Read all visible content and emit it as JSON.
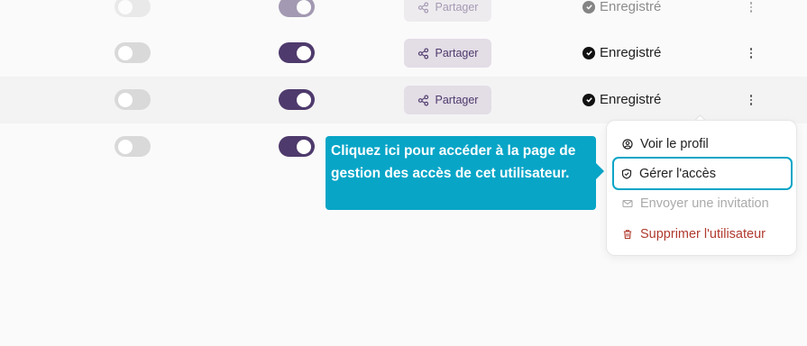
{
  "rows": [
    {
      "toggle1": false,
      "toggle2": true,
      "share_label": "Partager",
      "status": "Enregistré"
    },
    {
      "toggle1": false,
      "toggle2": true,
      "share_label": "Partager",
      "status": "Enregistré"
    },
    {
      "toggle1": false,
      "toggle2": true,
      "share_label": "Partager",
      "status": "Enregistré"
    },
    {
      "toggle1": false,
      "toggle2": true
    }
  ],
  "tooltip": {
    "text": "Cliquez ici pour accéder à la page de gestion des accès de cet utilisateur."
  },
  "menu": {
    "items": [
      {
        "label": "Voir le profil",
        "icon": "user-circle-icon"
      },
      {
        "label": "Gérer l'accès",
        "icon": "shield-icon"
      },
      {
        "label": "Envoyer une invitation",
        "icon": "mail-icon",
        "disabled": true
      },
      {
        "label": "Supprimer l'utilisateur",
        "icon": "trash-icon"
      }
    ]
  },
  "colors": {
    "accent": "#08a5c7",
    "toggle_on": "#4e3a6c",
    "toggle_off": "#d9d9d9",
    "danger": "#b03a2e",
    "share_bg": "#e3dde6"
  }
}
